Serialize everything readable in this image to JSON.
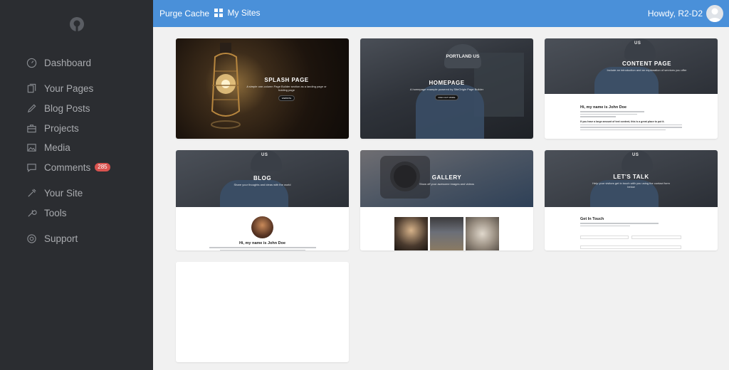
{
  "sidebar": {
    "items": [
      {
        "label": "Dashboard",
        "icon": "dashboard-gauge-icon"
      },
      {
        "label": "Your Pages",
        "icon": "pages-icon"
      },
      {
        "label": "Blog Posts",
        "icon": "pencil-icon"
      },
      {
        "label": "Projects",
        "icon": "briefcase-icon"
      },
      {
        "label": "Media",
        "icon": "image-icon"
      },
      {
        "label": "Comments",
        "icon": "comment-icon",
        "badge": "285"
      },
      {
        "label": "Your Site",
        "icon": "wrench-hammer-icon"
      },
      {
        "label": "Tools",
        "icon": "wrench-icon"
      },
      {
        "label": "Support",
        "icon": "lifebuoy-icon"
      }
    ]
  },
  "topbar": {
    "purge_label": "Purge Cache",
    "sites_label": "My Sites",
    "howdy_label": "Howdy, R2-D2"
  },
  "colors": {
    "sidebar_bg": "#2b2d31",
    "topbar_bg": "#4a90d9",
    "badge": "#d9534f",
    "content_bg": "#f1f1f1"
  },
  "cards": [
    {
      "title": "SPLASH PAGE",
      "subtitle": "A simple one-column Page Builder section as a landing page or holding page",
      "button": "WEBSITE"
    },
    {
      "title": "HOMEPAGE",
      "subtitle": "A homepage example powered by SiteOrigin Page Builder",
      "button": "FIND OUT MORE",
      "cap_text": "PORTLAND US"
    },
    {
      "title": "CONTENT PAGE",
      "subtitle": "Include an introduction and an explanation of services you offer",
      "cap_text": "US",
      "body_heading": "Hi, my name is John Doe",
      "body_sub": "If you have a large amount of text content, this is a great place to put it."
    },
    {
      "title": "BLOG",
      "subtitle": "Share your thoughts and ideas with the world",
      "cap_text": "US",
      "body_heading": "Hi, my name is John Doe"
    },
    {
      "title": "GALLERY",
      "subtitle": "Show off your awesome images and videos"
    },
    {
      "title": "LET'S TALK",
      "subtitle": "Help your visitors get in touch with you using the contact form below",
      "cap_text": "US",
      "body_heading": "Get In Touch"
    },
    {
      "title": ""
    }
  ]
}
